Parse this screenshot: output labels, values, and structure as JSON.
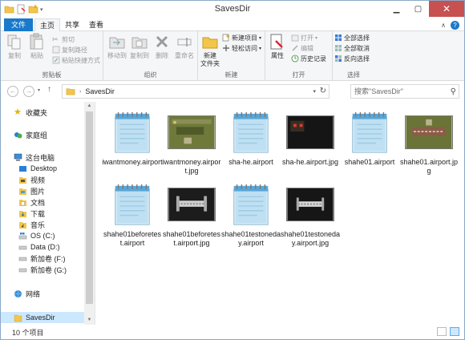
{
  "window": {
    "title": "SavesDir"
  },
  "ribbon_tabs": {
    "file": "文件",
    "home": "主页",
    "share": "共享",
    "view": "查看"
  },
  "ribbon": {
    "clipboard": {
      "label": "剪贴板",
      "copy": "复制",
      "paste": "粘贴",
      "cut": "剪切",
      "copy_path": "复制路径",
      "paste_shortcut": "粘贴快捷方式"
    },
    "organize": {
      "label": "组织",
      "move_to": "移动到",
      "copy_to": "复制到",
      "delete": "删除",
      "rename": "重命名"
    },
    "new": {
      "label": "新建",
      "new_folder": "新建\n文件夹",
      "new_item": "新建项目",
      "easy_access": "轻松访问"
    },
    "open": {
      "label": "打开",
      "properties": "属性",
      "open": "打开",
      "edit": "编辑",
      "history": "历史记录"
    },
    "select": {
      "label": "选择",
      "select_all": "全部选择",
      "select_none": "全部取消",
      "invert": "反向选择"
    }
  },
  "address": {
    "path": "SavesDir",
    "search_placeholder": "搜索\"SavesDir\""
  },
  "nav": {
    "favorites": "收藏夹",
    "homegroup": "家庭组",
    "this_pc": "这台电脑",
    "desktop": "Desktop",
    "videos": "视频",
    "pictures": "图片",
    "documents": "文档",
    "downloads": "下载",
    "music": "音乐",
    "os_c": "OS (C:)",
    "data_d": "Data (D:)",
    "vol_f": "新加卷 (F:)",
    "vol_g": "新加卷 (G:)",
    "network": "网络",
    "savesdir": "SavesDir"
  },
  "files": [
    {
      "name": "iwantmoney.airport",
      "kind": "doc"
    },
    {
      "name": "iwantmoney.airport.jpg",
      "kind": "img-green"
    },
    {
      "name": "sha-he.airport",
      "kind": "doc"
    },
    {
      "name": "sha-he.airport.jpg",
      "kind": "img-dark"
    },
    {
      "name": "shahe01.airport",
      "kind": "doc"
    },
    {
      "name": "shahe01.airport.jpg",
      "kind": "img-green2"
    },
    {
      "name": "shahe01beforetest.airport",
      "kind": "doc"
    },
    {
      "name": "shahe01beforetest.airport.jpg",
      "kind": "img-gray"
    },
    {
      "name": "shahe01testoneday.airport",
      "kind": "doc"
    },
    {
      "name": "shahe01testoneday.airport.jpg",
      "kind": "img-gray2"
    }
  ],
  "status": {
    "count": "10 个项目"
  },
  "colors": {
    "file_tab": "#1979ca",
    "close_button": "#c75050",
    "selection": "#cce8ff"
  }
}
